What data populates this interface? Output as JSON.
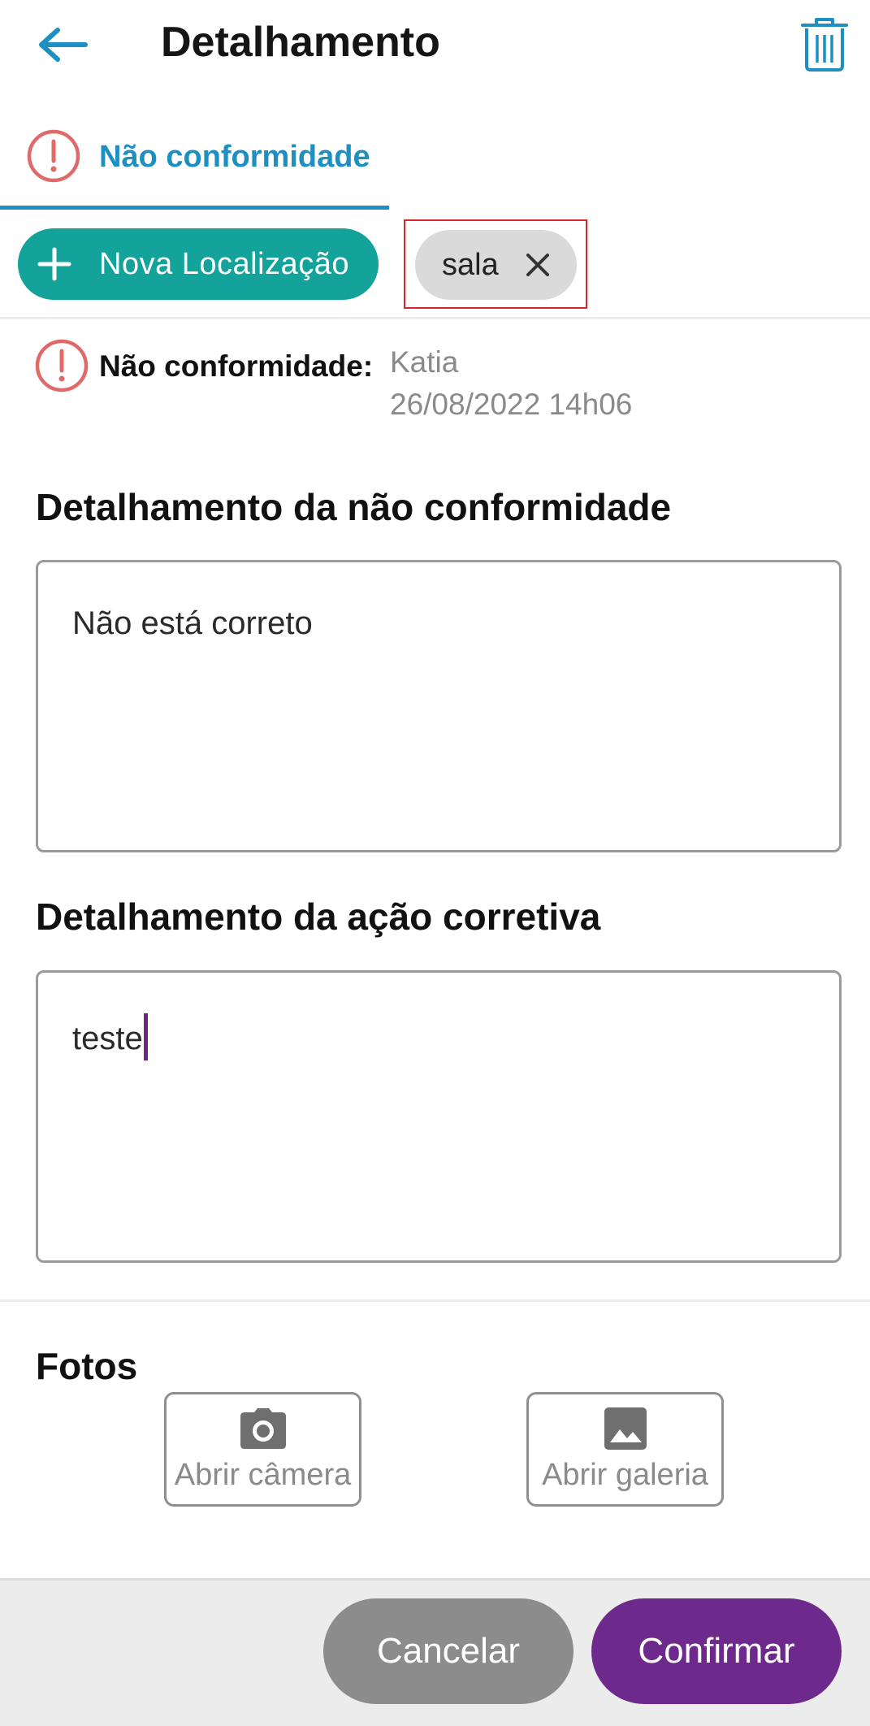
{
  "header": {
    "title": "Detalhamento",
    "back_icon": "arrow-left-icon",
    "delete_icon": "trash-icon",
    "accent_color": "#1d8fc0"
  },
  "tab": {
    "label": "Não conformidade",
    "icon": "alert-circle-icon"
  },
  "locations": {
    "new_button_label": "Nova Localização",
    "new_button_color": "#14a39a",
    "chips": [
      {
        "label": "sala"
      }
    ]
  },
  "nonconformity": {
    "label": "Não conformidade:",
    "author": "Katia",
    "datetime": "26/08/2022 14h06",
    "icon_color": "#e06a6a"
  },
  "details": {
    "nc_title": "Detalhamento da não conformidade",
    "nc_text": "Não está correto",
    "action_title": "Detalhamento da ação corretiva",
    "action_text": "teste"
  },
  "photos": {
    "title": "Fotos",
    "camera_label": "Abrir câmera",
    "gallery_label": "Abrir galeria"
  },
  "actions": {
    "cancel_label": "Cancelar",
    "confirm_label": "Confirmar",
    "confirm_color": "#6d2a8c"
  }
}
